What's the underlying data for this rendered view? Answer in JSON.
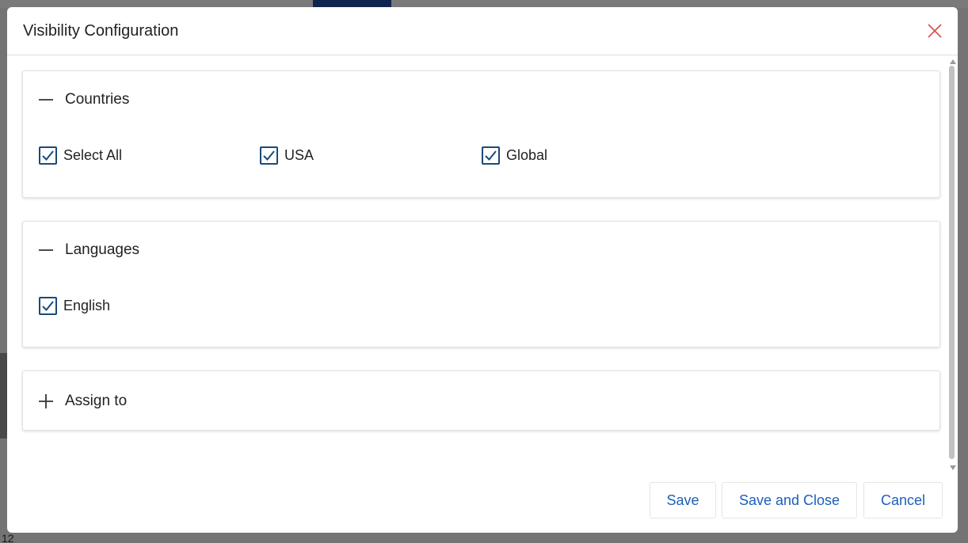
{
  "dialog": {
    "title": "Visibility Configuration",
    "close_icon": "close-icon",
    "accent_color": "#1d5fb8",
    "close_color": "#d9534f"
  },
  "sections": {
    "countries": {
      "title": "Countries",
      "expanded": true,
      "toggle_icon": "minus-icon",
      "options": [
        {
          "label": "Select All",
          "checked": true
        },
        {
          "label": "USA",
          "checked": true
        },
        {
          "label": "Global",
          "checked": true
        }
      ]
    },
    "languages": {
      "title": "Languages",
      "expanded": true,
      "toggle_icon": "minus-icon",
      "options": [
        {
          "label": "English",
          "checked": true
        }
      ]
    },
    "assign_to": {
      "title": "Assign to",
      "expanded": false,
      "toggle_icon": "plus-icon"
    }
  },
  "footer": {
    "save_label": "Save",
    "save_close_label": "Save and Close",
    "cancel_label": "Cancel"
  },
  "background": {
    "row_number": "12"
  }
}
